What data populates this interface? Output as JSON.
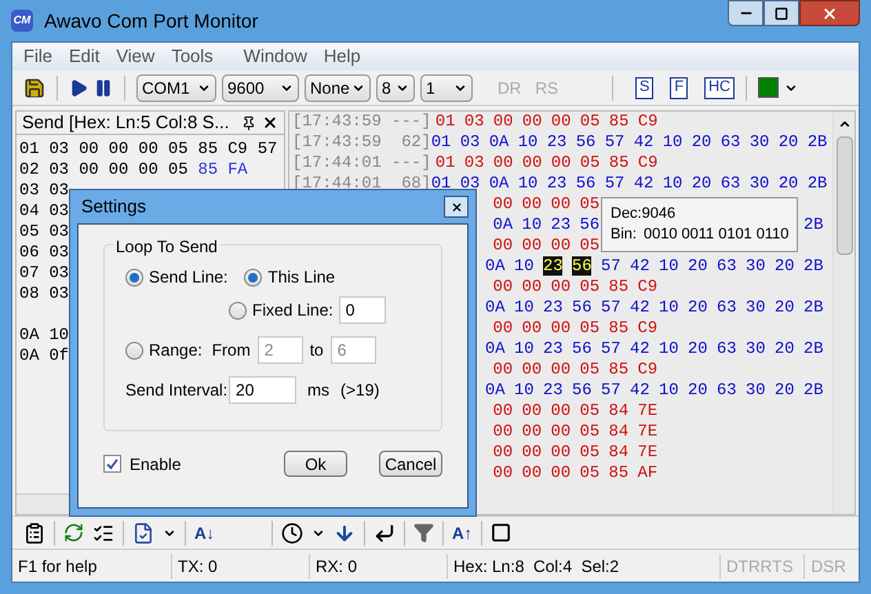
{
  "window": {
    "title": "Awavo Com Port Monitor",
    "logo": "CM"
  },
  "menu": [
    "File",
    "Edit",
    "View",
    "Tools",
    "Window",
    "Help"
  ],
  "toolbar": {
    "combos": [
      "COM1",
      "9600",
      "None",
      "8",
      "1"
    ],
    "signals": [
      {
        "label": "DR",
        "on": false
      },
      {
        "label": "RS",
        "on": false
      }
    ],
    "buttons": [
      "S",
      "F",
      "HC"
    ],
    "color": "#008000"
  },
  "send_panel": {
    "title": "Send [Hex: Ln:5 Col:8 S...",
    "lines": [
      {
        "text": "01 03 00 00 00 05 85 C9 57"
      },
      {
        "text": "02 03 00 00 00 05",
        "accent": "85 FA"
      },
      {
        "text": "03 03"
      },
      {
        "text": "04 03"
      },
      {
        "text": "05 03"
      },
      {
        "text": "06 03"
      },
      {
        "text": "07 03"
      },
      {
        "text": "08 03"
      },
      {
        "text": "0A 10",
        "gap_before": true
      },
      {
        "text": "0A 0f"
      }
    ]
  },
  "log": {
    "rows": [
      {
        "time": "[17:43:59 ---]",
        "kind": "tx",
        "covered": false,
        "bytes": [
          "01",
          "03",
          "00",
          "00",
          "00",
          "05",
          "85",
          "C9"
        ]
      },
      {
        "time": "[17:43:59  62]",
        "kind": "rx",
        "covered": false,
        "bytes": [
          "01",
          "03",
          "0A",
          "10",
          "23",
          "56",
          "57",
          "42",
          "10",
          "20",
          "63",
          "30",
          "20",
          "2B"
        ]
      },
      {
        "time": "[17:44:01 ---]",
        "kind": "tx",
        "covered": false,
        "bytes": [
          "01",
          "03",
          "00",
          "00",
          "00",
          "05",
          "85",
          "C9"
        ]
      },
      {
        "time": "[17:44:01  68]",
        "kind": "rx",
        "covered": false,
        "bytes": [
          "01",
          "03",
          "0A",
          "10",
          "23",
          "56",
          "57",
          "42",
          "10",
          "20",
          "63",
          "30",
          "20",
          "2B"
        ]
      },
      {
        "kind": "tx",
        "covered": true,
        "bytes": [
          "00",
          "00",
          "00",
          "05"
        ]
      },
      {
        "kind": "rx",
        "covered": true,
        "bytes": [
          "0A",
          "10",
          "23",
          "56"
        ],
        "tail": [
          "2B"
        ]
      },
      {
        "kind": "tx",
        "covered": true,
        "bytes": [
          "00",
          "00",
          "00",
          "05"
        ]
      },
      {
        "kind": "rx",
        "covered": true,
        "bytes": [
          {
            "text": "0A",
            "selected": false
          },
          {
            "text": "10",
            "selected": false
          },
          {
            "text": "23",
            "selected": true
          },
          {
            "text": "56",
            "selected": true
          },
          {
            "text": "57",
            "selected": false
          },
          {
            "text": "42",
            "selected": false
          },
          {
            "text": "10",
            "selected": false
          },
          {
            "text": "20",
            "selected": false
          },
          {
            "text": "63",
            "selected": false
          },
          {
            "text": "30",
            "selected": false
          },
          {
            "text": "20",
            "selected": false
          },
          {
            "text": "2B",
            "selected": false
          }
        ]
      },
      {
        "kind": "tx",
        "covered": true,
        "bytes": [
          "00",
          "00",
          "00",
          "05",
          "85",
          "C9"
        ]
      },
      {
        "kind": "rx",
        "covered": true,
        "bytes": [
          "0A",
          "10",
          "23",
          "56",
          "57",
          "42",
          "10",
          "20",
          "63",
          "30",
          "20",
          "2B"
        ]
      },
      {
        "kind": "tx",
        "covered": true,
        "bytes": [
          "00",
          "00",
          "00",
          "05",
          "85",
          "C9"
        ]
      },
      {
        "kind": "rx",
        "covered": true,
        "bytes": [
          "0A",
          "10",
          "23",
          "56",
          "57",
          "42",
          "10",
          "20",
          "63",
          "30",
          "20",
          "2B"
        ]
      },
      {
        "kind": "tx",
        "covered": true,
        "bytes": [
          "00",
          "00",
          "00",
          "05",
          "85",
          "C9"
        ]
      },
      {
        "kind": "rx",
        "covered": true,
        "bytes": [
          "0A",
          "10",
          "23",
          "56",
          "57",
          "42",
          "10",
          "20",
          "63",
          "30",
          "20",
          "2B"
        ]
      },
      {
        "kind": "tx",
        "covered": true,
        "bytes": [
          "00",
          "00",
          "00",
          "05",
          "84",
          "7E"
        ]
      },
      {
        "kind": "tx",
        "covered": true,
        "bytes": [
          "00",
          "00",
          "00",
          "05",
          "84",
          "7E"
        ]
      },
      {
        "kind": "tx",
        "covered": true,
        "bytes": [
          "00",
          "00",
          "00",
          "05",
          "84",
          "7E"
        ]
      },
      {
        "kind": "tx",
        "covered": true,
        "bytes": [
          "00",
          "00",
          "00",
          "05",
          "85",
          "AF"
        ]
      }
    ],
    "tooltip": {
      "dec_label": "Dec:",
      "dec": "9046",
      "bin_label": "Bin:",
      "bin": "0010 0011 0101 0110"
    }
  },
  "bottom_toolbar": {
    "sort_down": "A↓",
    "sort_up": "A↑"
  },
  "dialog": {
    "title": "Settings",
    "group": "Loop To Send",
    "send_line": {
      "label": "Send Line:",
      "selected": true
    },
    "this_line": {
      "label": "This Line",
      "selected": true
    },
    "fixed_line": {
      "label": "Fixed Line:",
      "selected": false,
      "value": "0"
    },
    "range": {
      "label": "Range:",
      "selected": false,
      "from_label": "From",
      "from": "2",
      "to_label": "to",
      "to": "6"
    },
    "interval": {
      "label": "Send Interval:",
      "value": "20",
      "unit": "ms",
      "hint": "(>19)"
    },
    "enable": {
      "label": "Enable",
      "checked": true
    },
    "buttons": [
      "Ok",
      "Cancel"
    ]
  },
  "status_bar": {
    "help": "F1 for help",
    "tx": "TX: 0",
    "rx": "RX: 0",
    "position": "Hex: Ln:8  Col:4  Sel:2",
    "signals": [
      {
        "label": "DTR",
        "on": false
      },
      {
        "label": "RTS",
        "on": false
      },
      {
        "label": "DSR",
        "on": false
      }
    ]
  }
}
